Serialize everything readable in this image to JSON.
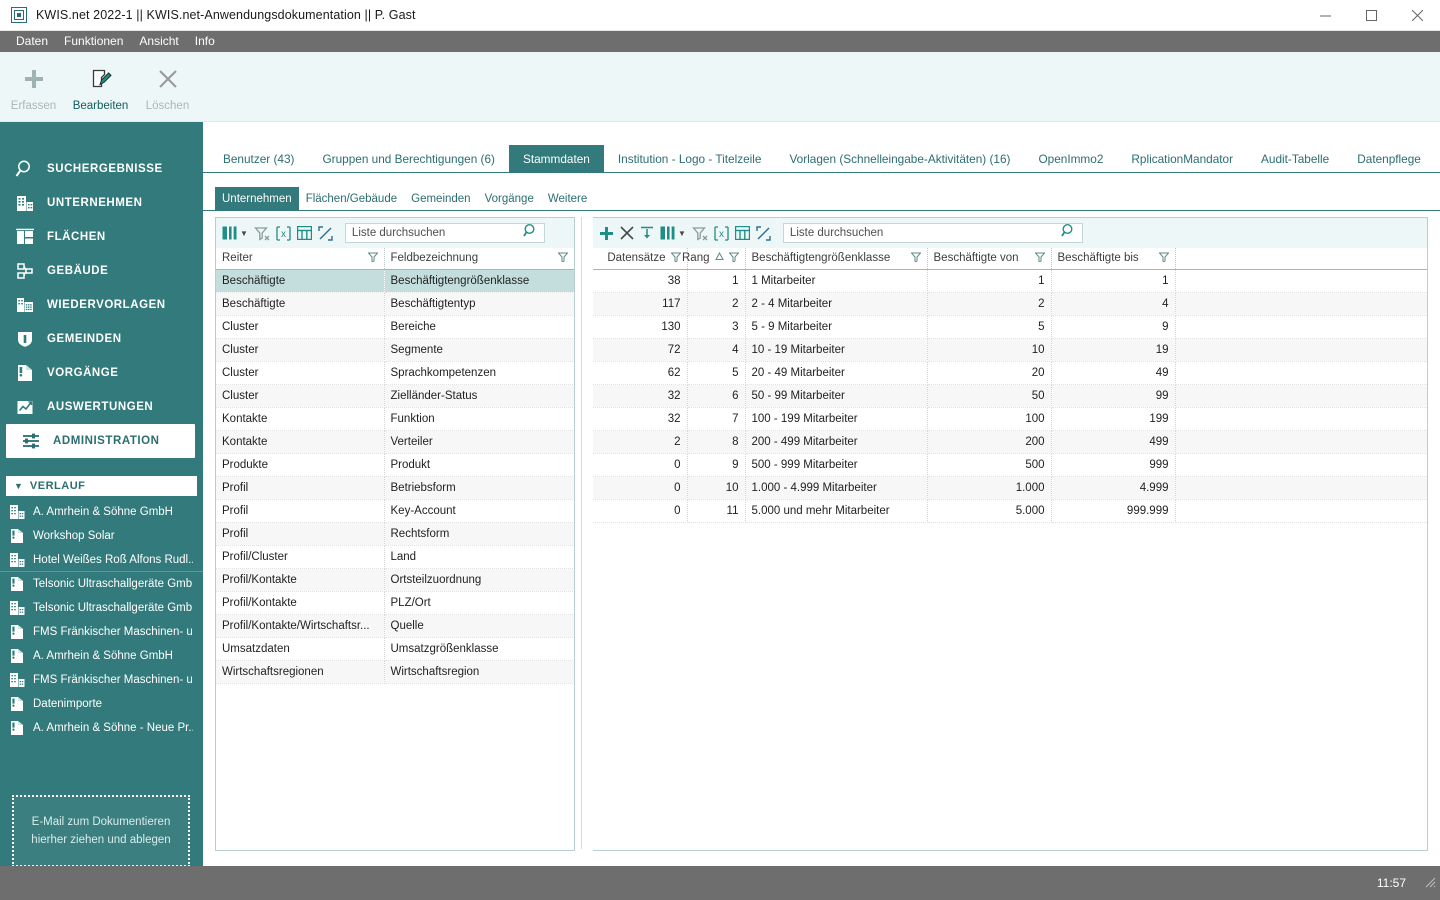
{
  "window": {
    "title": "KWIS.net 2022-1 || KWIS.net-Anwendungsdokumentation || P. Gast",
    "logo_icon": "app-logo-icon",
    "minimize": "minimize-icon",
    "maximize": "maximize-icon",
    "close": "close-icon"
  },
  "menu": {
    "items": [
      {
        "label": "Daten"
      },
      {
        "label": "Funktionen"
      },
      {
        "label": "Ansicht"
      },
      {
        "label": "Info"
      }
    ]
  },
  "ribbon": {
    "buttons": [
      {
        "label": "Erfassen",
        "icon": "plus-icon",
        "enabled": false
      },
      {
        "label": "Bearbeiten",
        "icon": "edit-pencil-icon",
        "enabled": true
      },
      {
        "label": "Löschen",
        "icon": "close-x-icon",
        "enabled": false
      }
    ]
  },
  "sidebar": {
    "items": [
      {
        "label": "SUCHERGEBNISSE",
        "icon": "magnifier-icon",
        "active": false
      },
      {
        "label": "UNTERNEHMEN",
        "icon": "building-icon",
        "active": false
      },
      {
        "label": "FLÄCHEN",
        "icon": "area-icon",
        "active": false
      },
      {
        "label": "GEBÄUDE",
        "icon": "blueprint-icon",
        "active": false
      },
      {
        "label": "WIEDERVORLAGEN",
        "icon": "calendar-building-icon",
        "active": false
      },
      {
        "label": "GEMEINDEN",
        "icon": "shield-icon",
        "active": false
      },
      {
        "label": "VORGÄNGE",
        "icon": "binder-icon",
        "active": false
      },
      {
        "label": "AUSWERTUNGEN",
        "icon": "chart-icon",
        "active": false
      },
      {
        "label": "ADMINISTRATION",
        "icon": "sliders-icon",
        "active": true
      }
    ],
    "history": {
      "title": "VERLAUF",
      "caret": "caret-down-icon",
      "items": [
        {
          "label": "A. Amrhein & Söhne GmbH",
          "icon": "building-icon"
        },
        {
          "label": "Workshop Solar",
          "icon": "binder-icon"
        },
        {
          "label": "Hotel Weißes Roß Alfons Rudl...",
          "icon": "building-icon"
        },
        {
          "label": "Telsonic Ultraschallgeräte Gmb...",
          "icon": "binder-icon"
        },
        {
          "label": "Telsonic Ultraschallgeräte Gmb...",
          "icon": "building-icon"
        },
        {
          "label": "FMS Fränkischer Maschinen- u...",
          "icon": "binder-icon"
        },
        {
          "label": "A. Amrhein & Söhne GmbH",
          "icon": "binder-icon"
        },
        {
          "label": "FMS Fränkischer Maschinen- u...",
          "icon": "building-icon"
        },
        {
          "label": "Datenimporte",
          "icon": "binder-icon"
        },
        {
          "label": "A. Amrhein & Söhne - Neue Pr...",
          "icon": "binder-icon"
        }
      ]
    },
    "dropzone": {
      "line1": "E-Mail  zum Dokumentieren",
      "line2": "hierher ziehen und ablegen"
    }
  },
  "main": {
    "tabs": [
      {
        "label": "Benutzer (43)",
        "active": false
      },
      {
        "label": "Gruppen und Berechtigungen (6)",
        "active": false
      },
      {
        "label": "Stammdaten",
        "active": true
      },
      {
        "label": "Institution - Logo - Titelzeile",
        "active": false
      },
      {
        "label": "Vorlagen (Schnelleingabe-Aktivitäten) (16)",
        "active": false
      },
      {
        "label": "OpenImmo2",
        "active": false
      },
      {
        "label": "RplicationMandator",
        "active": false
      },
      {
        "label": "Audit-Tabelle",
        "active": false
      },
      {
        "label": "Datenpflege",
        "active": false
      }
    ],
    "subtabs": [
      {
        "label": "Unternehmen",
        "active": true
      },
      {
        "label": "Flächen/Gebäude",
        "active": false
      },
      {
        "label": "Gemeinden",
        "active": false
      },
      {
        "label": "Vorgänge",
        "active": false
      },
      {
        "label": "Weitere",
        "active": false
      }
    ]
  },
  "left_panel": {
    "toolbar": {
      "icons": [
        "column-chooser-icon",
        "caret-down-icon",
        "clear-filter-icon",
        "excel-export-icon",
        "grid-layout-icon",
        "expand-all-icon"
      ],
      "search_placeholder": "Liste durchsuchen",
      "search_icon": "search-icon"
    },
    "columns": [
      {
        "label": "Reiter",
        "filter_icon": "filter-icon"
      },
      {
        "label": "Feldbezeichnung",
        "filter_icon": "filter-icon"
      }
    ],
    "rows": [
      {
        "reiter": "Beschäftigte",
        "feld": "Beschäftigtengrößenklasse",
        "selected": true
      },
      {
        "reiter": "Beschäftigte",
        "feld": "Beschäftigtentyp",
        "selected": false
      },
      {
        "reiter": "Cluster",
        "feld": "Bereiche",
        "selected": false
      },
      {
        "reiter": "Cluster",
        "feld": "Segmente",
        "selected": false
      },
      {
        "reiter": "Cluster",
        "feld": "Sprachkompetenzen",
        "selected": false
      },
      {
        "reiter": "Cluster",
        "feld": "Zielländer-Status",
        "selected": false
      },
      {
        "reiter": "Kontakte",
        "feld": "Funktion",
        "selected": false
      },
      {
        "reiter": "Kontakte",
        "feld": "Verteiler",
        "selected": false
      },
      {
        "reiter": "Produkte",
        "feld": "Produkt",
        "selected": false
      },
      {
        "reiter": "Profil",
        "feld": "Betriebsform",
        "selected": false
      },
      {
        "reiter": "Profil",
        "feld": "Key-Account",
        "selected": false
      },
      {
        "reiter": "Profil",
        "feld": "Rechtsform",
        "selected": false
      },
      {
        "reiter": "Profil/Cluster",
        "feld": "Land",
        "selected": false
      },
      {
        "reiter": "Profil/Kontakte",
        "feld": "Ortsteilzuordnung",
        "selected": false
      },
      {
        "reiter": "Profil/Kontakte",
        "feld": "PLZ/Ort",
        "selected": false
      },
      {
        "reiter": "Profil/Kontakte/Wirtschaftsr...",
        "feld": "Quelle",
        "selected": false
      },
      {
        "reiter": "Umsatzdaten",
        "feld": "Umsatzgrößenklasse",
        "selected": false
      },
      {
        "reiter": "Wirtschaftsregionen",
        "feld": "Wirtschaftsregion",
        "selected": false
      }
    ]
  },
  "right_panel": {
    "toolbar": {
      "icons": [
        "plus-icon",
        "close-x-icon",
        "sort-down-icon",
        "column-chooser-icon",
        "caret-down-icon",
        "clear-filter-icon",
        "excel-export-icon",
        "grid-layout-icon",
        "expand-all-icon"
      ],
      "search_placeholder": "Liste durchsuchen",
      "search_icon": "search-icon"
    },
    "columns": [
      {
        "label": "Datensätze",
        "filter_icon": "filter-icon",
        "sort_icon": ""
      },
      {
        "label": "Rang",
        "filter_icon": "filter-icon",
        "sort_icon": "sort-asc-icon"
      },
      {
        "label": "Beschäftigtengrößenklasse",
        "filter_icon": "filter-icon",
        "sort_icon": ""
      },
      {
        "label": "Beschäftigte von",
        "filter_icon": "filter-icon",
        "sort_icon": ""
      },
      {
        "label": "Beschäftigte bis",
        "filter_icon": "filter-icon",
        "sort_icon": ""
      }
    ],
    "rows": [
      {
        "datensaetze": "38",
        "rang": "1",
        "klasse": "1 Mitarbeiter",
        "von": "1",
        "bis": "1"
      },
      {
        "datensaetze": "117",
        "rang": "2",
        "klasse": "2 - 4 Mitarbeiter",
        "von": "2",
        "bis": "4"
      },
      {
        "datensaetze": "130",
        "rang": "3",
        "klasse": "5 - 9 Mitarbeiter",
        "von": "5",
        "bis": "9"
      },
      {
        "datensaetze": "72",
        "rang": "4",
        "klasse": "10 - 19 Mitarbeiter",
        "von": "10",
        "bis": "19"
      },
      {
        "datensaetze": "62",
        "rang": "5",
        "klasse": "20 - 49 Mitarbeiter",
        "von": "20",
        "bis": "49"
      },
      {
        "datensaetze": "32",
        "rang": "6",
        "klasse": "50 - 99 Mitarbeiter",
        "von": "50",
        "bis": "99"
      },
      {
        "datensaetze": "32",
        "rang": "7",
        "klasse": "100 - 199 Mitarbeiter",
        "von": "100",
        "bis": "199"
      },
      {
        "datensaetze": "2",
        "rang": "8",
        "klasse": "200 - 499 Mitarbeiter",
        "von": "200",
        "bis": "499"
      },
      {
        "datensaetze": "0",
        "rang": "9",
        "klasse": "500 - 999 Mitarbeiter",
        "von": "500",
        "bis": "999"
      },
      {
        "datensaetze": "0",
        "rang": "10",
        "klasse": "1.000 - 4.999 Mitarbeiter",
        "von": "1.000",
        "bis": "4.999"
      },
      {
        "datensaetze": "0",
        "rang": "11",
        "klasse": "5.000 und mehr Mitarbeiter",
        "von": "5.000",
        "bis": "999.999"
      }
    ]
  },
  "statusbar": {
    "clock": "11:57",
    "grip_icon": "resize-grip-icon"
  },
  "colors": {
    "accent": "#327a7b",
    "accent_dark": "#2b6e70",
    "ribbon_bg": "#eef7f7",
    "chrome": "#6e6e6e",
    "selection": "#c3dedc"
  }
}
